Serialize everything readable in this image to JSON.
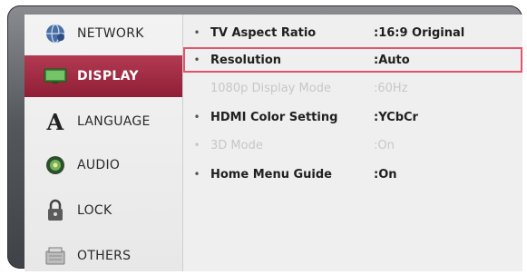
{
  "sidebar": {
    "items": [
      {
        "label": "NETWORK",
        "icon": "network-globe-icon"
      },
      {
        "label": "DISPLAY",
        "icon": "display-tv-icon"
      },
      {
        "label": "LANGUAGE",
        "icon": "language-letter-icon",
        "glyph": "A"
      },
      {
        "label": "AUDIO",
        "icon": "audio-speaker-icon"
      },
      {
        "label": "LOCK",
        "icon": "lock-icon"
      },
      {
        "label": "OTHERS",
        "icon": "others-box-icon"
      }
    ],
    "active_index": 1
  },
  "settings": [
    {
      "bullet": "•",
      "label": "TV Aspect Ratio",
      "value": ":16:9 Original",
      "state": "normal"
    },
    {
      "bullet": "•",
      "label": "Resolution",
      "value": ":Auto",
      "state": "selected"
    },
    {
      "bullet": "",
      "label": "1080p Display Mode",
      "value": ":60Hz",
      "state": "disabled"
    },
    {
      "bullet": "•",
      "label": "HDMI Color Setting",
      "value": ":YCbCr",
      "state": "normal"
    },
    {
      "bullet": "•",
      "label": "3D Mode",
      "value": ":On",
      "state": "disabled"
    },
    {
      "bullet": "•",
      "label": "Home Menu Guide",
      "value": ":On",
      "state": "normal"
    }
  ],
  "colors": {
    "active_item": "#9e2b43",
    "selection_outline": "#e0546e",
    "frame": "#54575b"
  }
}
